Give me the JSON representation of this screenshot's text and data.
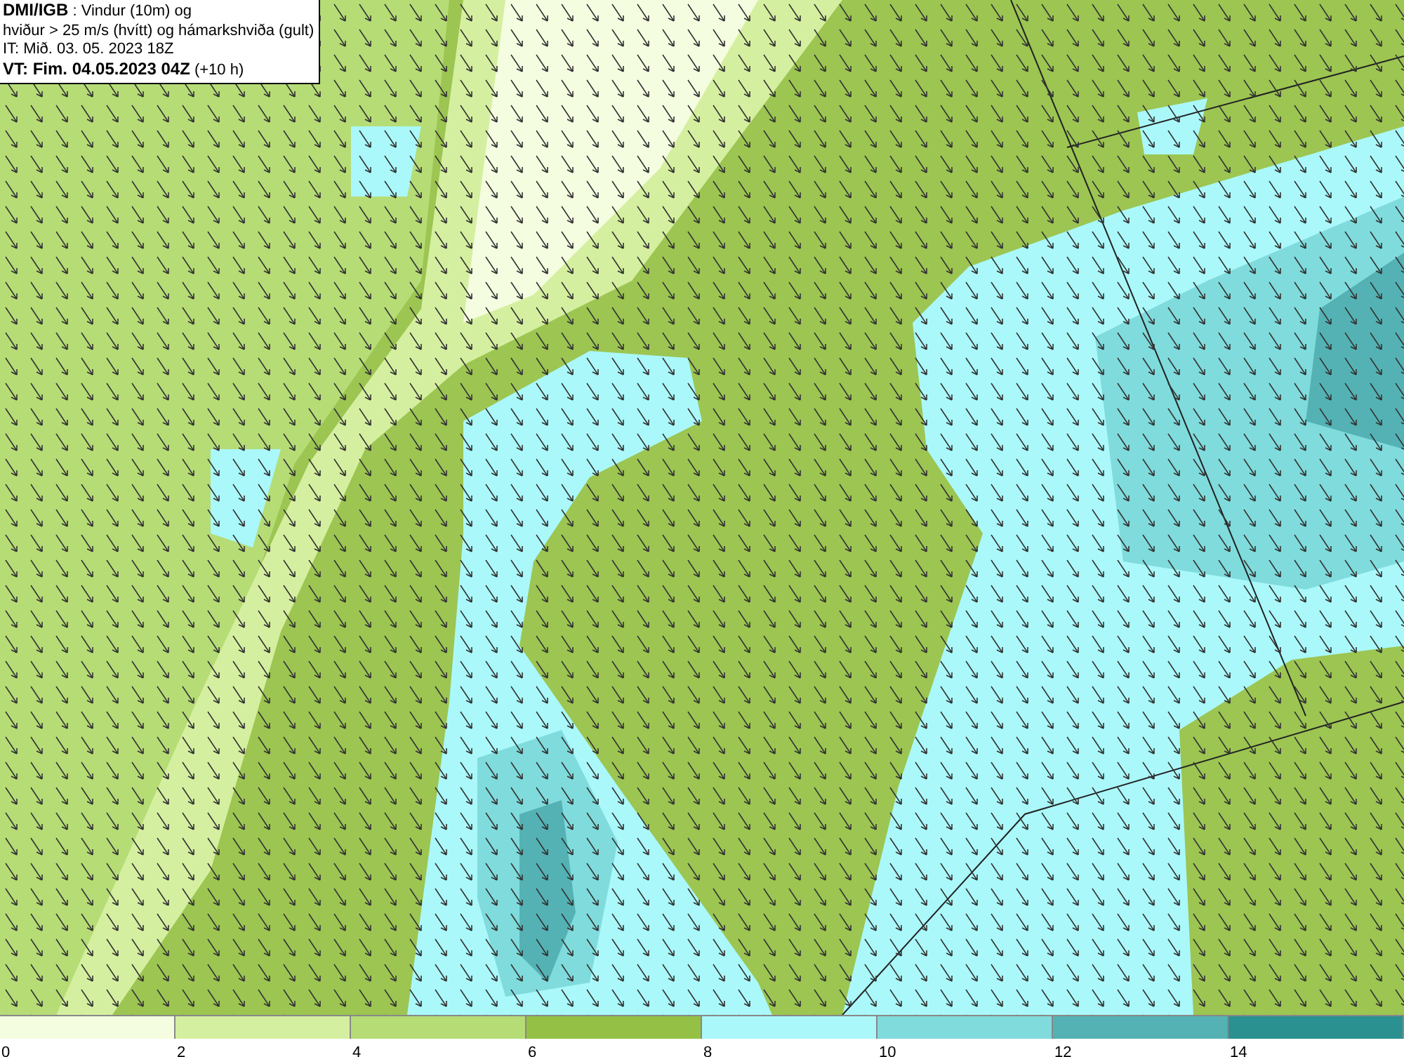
{
  "info_box": {
    "lines": [
      "**DMI/IGB** : Vindur (10m) og",
      "hviður > 25 m/s (hvítt) og hámarkshviða (gult)",
      "IT: Mið. 03. 05. 2023 18Z",
      "**VT: Fim. 04.05.2023 04Z** (+10 h)"
    ]
  },
  "legend": {
    "bins": [
      {
        "label": "0",
        "color": "#f4fde0"
      },
      {
        "label": "2",
        "color": "#d5efa0"
      },
      {
        "label": "4",
        "color": "#b6dc76"
      },
      {
        "label": "6",
        "color": "#94c145"
      },
      {
        "label": "8",
        "color": "#aaf8fa"
      },
      {
        "label": "10",
        "color": "#80dbdc"
      },
      {
        "label": "12",
        "color": "#54b2b4"
      },
      {
        "label": "14",
        "color": "#2a9190"
      }
    ]
  }
}
